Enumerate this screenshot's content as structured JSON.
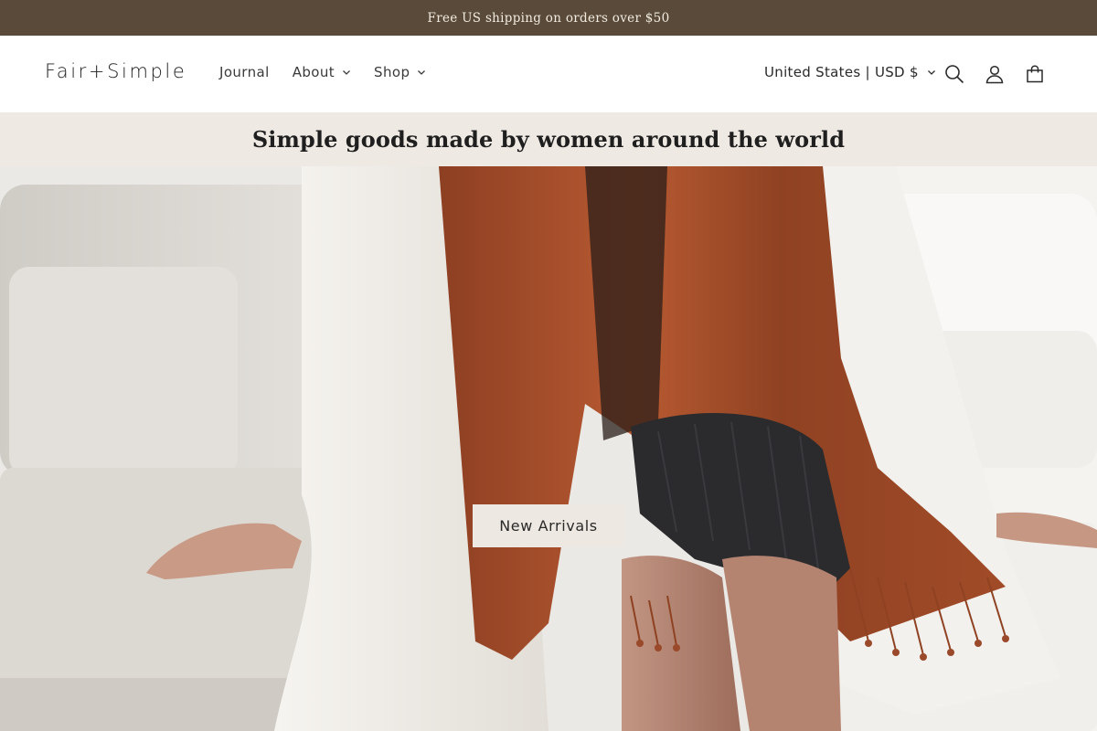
{
  "announcement": {
    "text": "Free US shipping on orders over $50"
  },
  "header": {
    "logo": "Fair+Simple",
    "nav": [
      {
        "label": "Journal",
        "has_dropdown": false
      },
      {
        "label": "About",
        "has_dropdown": true
      },
      {
        "label": "Shop",
        "has_dropdown": true
      }
    ],
    "country_selector": "United States | USD $",
    "icons": [
      "search-icon",
      "account-icon",
      "cart-icon"
    ]
  },
  "tagline": "Simple goods made by women around the world",
  "hero": {
    "button_label": "New Arrivals",
    "image_subject": ""
  },
  "colors": {
    "announcement_bg": "#5a4a39",
    "tagline_bg": "#eee9e3",
    "button_bg": "#ede8e1",
    "scarf_rust": "#9a4a2a"
  }
}
